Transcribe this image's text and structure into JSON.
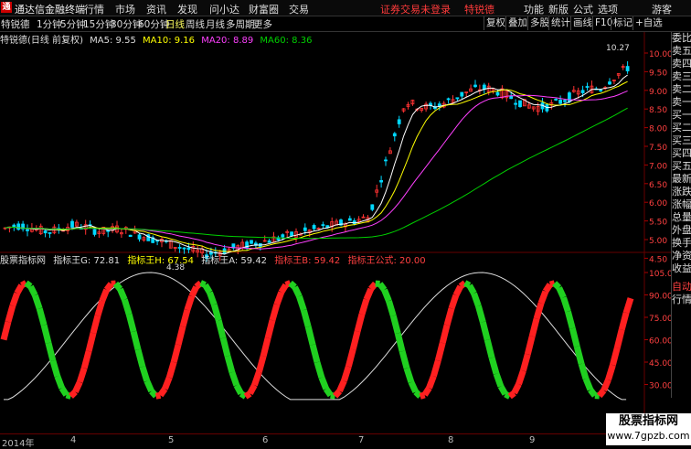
{
  "app": {
    "logo": "通",
    "title": "通达信金融终端"
  },
  "menu": [
    "行情",
    "市场",
    "资讯",
    "发现",
    "问小达",
    "财富圈",
    "交易"
  ],
  "login_status": "证券交易未登录",
  "stock_name_header": "特锐德",
  "top_right": [
    "功能",
    "新版",
    "公式",
    "选项"
  ],
  "guest_label": "游客",
  "periods": [
    "1分钟",
    "5分钟",
    "15分钟",
    "30分钟",
    "60分钟",
    "日线",
    "周线",
    "月线",
    "多周期",
    "更多"
  ],
  "active_period": "日线",
  "toolbar_right": [
    "复权",
    "叠加",
    "多股",
    "统计",
    "画线",
    "F10",
    "标记",
    "+自选"
  ],
  "kline_info": {
    "title": "特锐德(日线 前复权)",
    "ma5": "MA5: 9.55",
    "ma10": "MA10: 9.16",
    "ma20": "MA20: 8.89",
    "ma60": "MA60: 8.36",
    "high_label": "10.27",
    "low_label": "4.38"
  },
  "price_axis": [
    "10.00",
    "9.50",
    "9.00",
    "8.50",
    "8.00",
    "7.50",
    "7.00",
    "6.50",
    "6.00",
    "5.50",
    "5.00",
    "4.50"
  ],
  "sub_info": {
    "name": "股票指标网",
    "g": "指标王G: 72.81",
    "h": "指标王H: 67.54",
    "a": "指标王A: 59.42",
    "b": "指标王B: 59.42",
    "formula": "指标王公式: 20.00"
  },
  "sub_axis": [
    "105.0",
    "90.00",
    "75.00",
    "60.00",
    "45.00",
    "30.00"
  ],
  "right_panel": [
    "委比",
    "卖五",
    "卖四",
    "卖三",
    "卖二",
    "卖一",
    "买一",
    "买二",
    "买三",
    "买四",
    "买五",
    "最新",
    "涨跌",
    "涨幅",
    "总量",
    "外盘",
    "换手",
    "净资",
    "收益"
  ],
  "right_panel_bottom": [
    "自动",
    "行情"
  ],
  "x_axis": [
    "2014年",
    "4",
    "5",
    "6",
    "7",
    "8",
    "9"
  ],
  "watermark": {
    "line1": "股票指标网",
    "line2": "www.7gpzb.com"
  },
  "colors": {
    "up": "#ff3232",
    "down": "#00d8ff",
    "ma5": "#ffffff",
    "ma10": "#ffff00",
    "ma20": "#ff40ff",
    "ma60": "#00d000",
    "ind_red": "#ff2020",
    "ind_green": "#20d020"
  }
}
